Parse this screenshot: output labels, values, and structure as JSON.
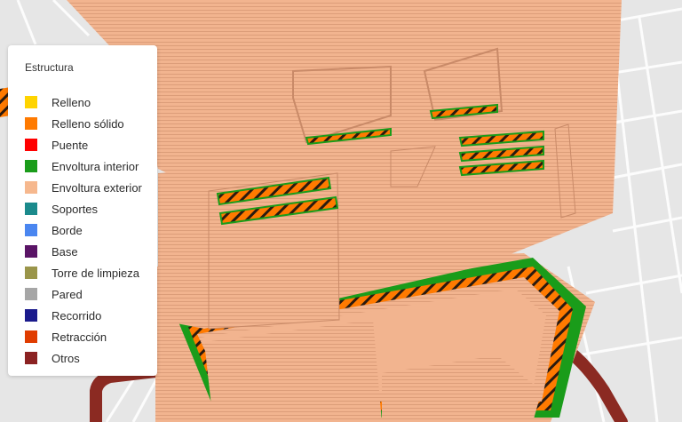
{
  "legend": {
    "title": "Estructura",
    "items": [
      {
        "label": "Relleno",
        "color": "#ffd400"
      },
      {
        "label": "Relleno sólido",
        "color": "#ff7a00"
      },
      {
        "label": "Puente",
        "color": "#ff0000"
      },
      {
        "label": "Envoltura interior",
        "color": "#1a9c1a"
      },
      {
        "label": "Envoltura exterior",
        "color": "#f6b88e"
      },
      {
        "label": "Soportes",
        "color": "#1b8a8c"
      },
      {
        "label": "Borde",
        "color": "#4a86f0"
      },
      {
        "label": "Base",
        "color": "#5a1466"
      },
      {
        "label": "Torre de limpieza",
        "color": "#9a954a"
      },
      {
        "label": "Pared",
        "color": "#a6a6a6"
      },
      {
        "label": "Recorrido",
        "color": "#1a1a8c"
      },
      {
        "label": "Retracción",
        "color": "#e03c00"
      },
      {
        "label": "Otros",
        "color": "#8b2222"
      }
    ]
  },
  "scene": {
    "object_color": "#f2b48f",
    "layer_line_color": "#c98a68",
    "infill_color": "#ff7a00",
    "inner_shell_color": "#1a9c1a",
    "support_tube_color": "#8b2a22",
    "grid_color": "#ffffff",
    "bed_color": "#e6e6e6"
  }
}
